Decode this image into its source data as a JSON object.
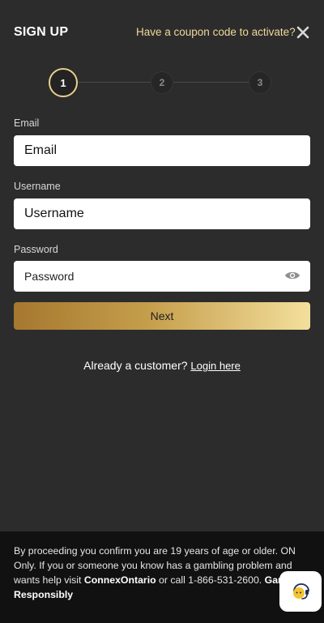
{
  "header": {
    "title": "SIGN UP",
    "coupon_link": "Have a coupon code to activate?",
    "close_icon": "close-icon"
  },
  "stepper": {
    "steps": [
      "1",
      "2",
      "3"
    ],
    "active_step": 1
  },
  "form": {
    "email": {
      "label": "Email",
      "placeholder": "Email",
      "value": ""
    },
    "username": {
      "label": "Username",
      "placeholder": "Username",
      "value": ""
    },
    "password": {
      "label": "Password",
      "placeholder": "Password",
      "value": "",
      "toggle_icon": "eye-icon"
    },
    "next_label": "Next"
  },
  "login": {
    "prompt": "Already a customer?",
    "link": "Login here"
  },
  "footer": {
    "text_1": "By proceeding you confirm you are 19 years of age or older. ON Only. If you or someone you know has a gambling problem and wants help visit ",
    "connex": "ConnexOntario",
    "text_2": " or call 1-866-531-2600. ",
    "gamble": "Gamble Responsibly"
  },
  "chat": {
    "icon": "chat-support-icon"
  },
  "colors": {
    "panel_bg": "#2c2c2c",
    "footer_bg": "#111111",
    "accent_gold": "#e9cf8e",
    "button_gradient_start": "#a5782f",
    "button_gradient_end": "#f3df9c"
  }
}
